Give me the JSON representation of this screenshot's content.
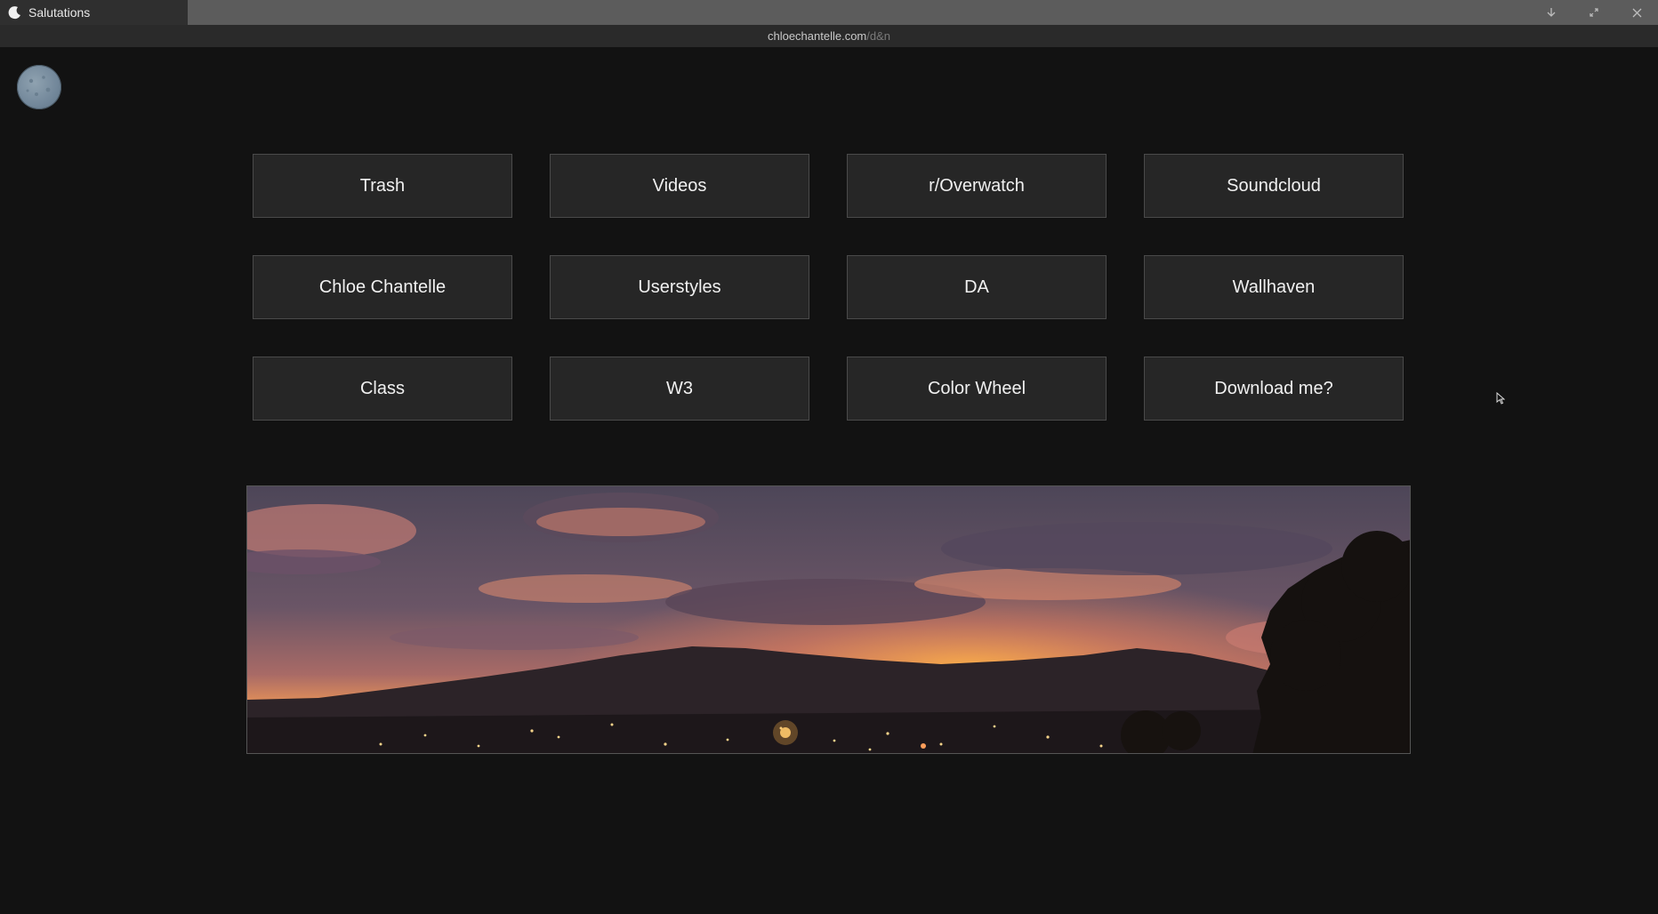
{
  "window": {
    "tab_title": "Salutations",
    "tab_icon": "moon-icon",
    "controls": [
      "download-icon",
      "restore-icon",
      "close-icon"
    ]
  },
  "urlbar": {
    "host": "chloechantelle.com",
    "path": "/d&n"
  },
  "links": [
    "Trash",
    "Videos",
    "r/Overwatch",
    "Soundcloud",
    "Chloe Chantelle",
    "Userstyles",
    "DA",
    "Wallhaven",
    "Class",
    "W3",
    "Color Wheel",
    "Download me?"
  ],
  "banner": {
    "icon": "city-sunset-panorama",
    "colors": {
      "sky_top": "#4a4456",
      "sky_glow": "#e88a6a",
      "horizon": "#f5a64a",
      "hills": "#2a2228",
      "city": "#1c171b"
    }
  },
  "colors": {
    "background": "#121212",
    "button_bg": "#262626",
    "button_border": "#4a4a4a",
    "button_text": "#f0f0f0"
  }
}
